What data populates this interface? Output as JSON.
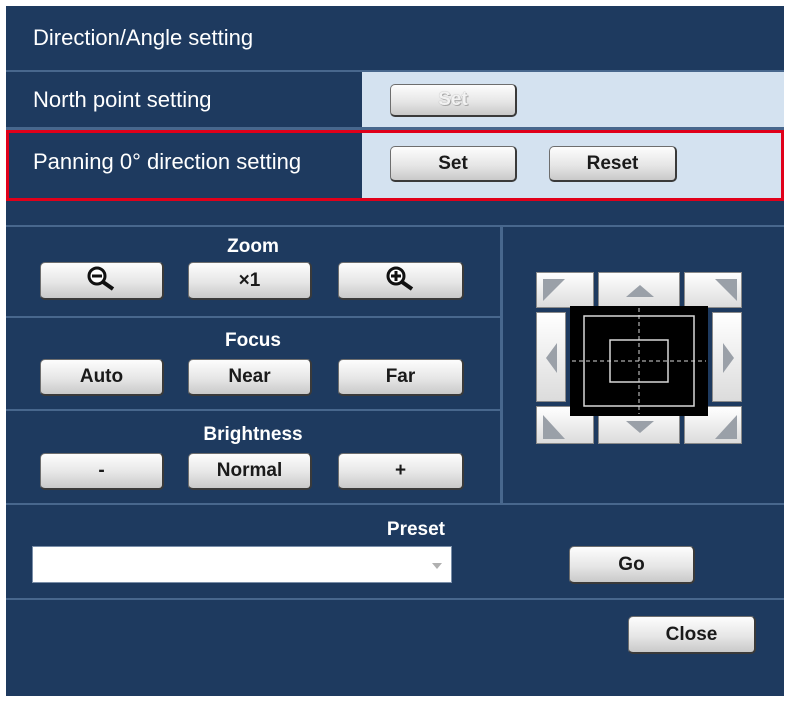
{
  "dialog": {
    "title": "Direction/Angle setting",
    "close_label": "Close"
  },
  "north_point": {
    "label": "North point setting",
    "set_label": "Set",
    "set_enabled": false
  },
  "panning": {
    "label": "Panning 0° direction setting",
    "set_label": "Set",
    "reset_label": "Reset",
    "highlighted": true,
    "highlight_color": "#e0001a"
  },
  "zoom": {
    "title": "Zoom",
    "zoom_out_icon": "zoom-out-magnifier-icon",
    "x1_label": "×1",
    "zoom_in_icon": "zoom-in-magnifier-icon"
  },
  "focus": {
    "title": "Focus",
    "auto_label": "Auto",
    "near_label": "Near",
    "far_label": "Far"
  },
  "brightness": {
    "title": "Brightness",
    "minus_label": "-",
    "normal_label": "Normal",
    "plus_label": "+"
  },
  "pan_tilt_pad": {
    "icons": [
      "up-left-arrow-icon",
      "up-arrow-icon",
      "up-right-arrow-icon",
      "left-arrow-icon",
      "right-arrow-icon",
      "down-left-arrow-icon",
      "down-arrow-icon",
      "down-right-arrow-icon"
    ]
  },
  "preset": {
    "title": "Preset",
    "selected_value": "",
    "go_label": "Go"
  },
  "colors": {
    "panel_bg": "#1e3a5f",
    "light_cell_bg": "#d4e2f0",
    "separator": "#48678d"
  }
}
